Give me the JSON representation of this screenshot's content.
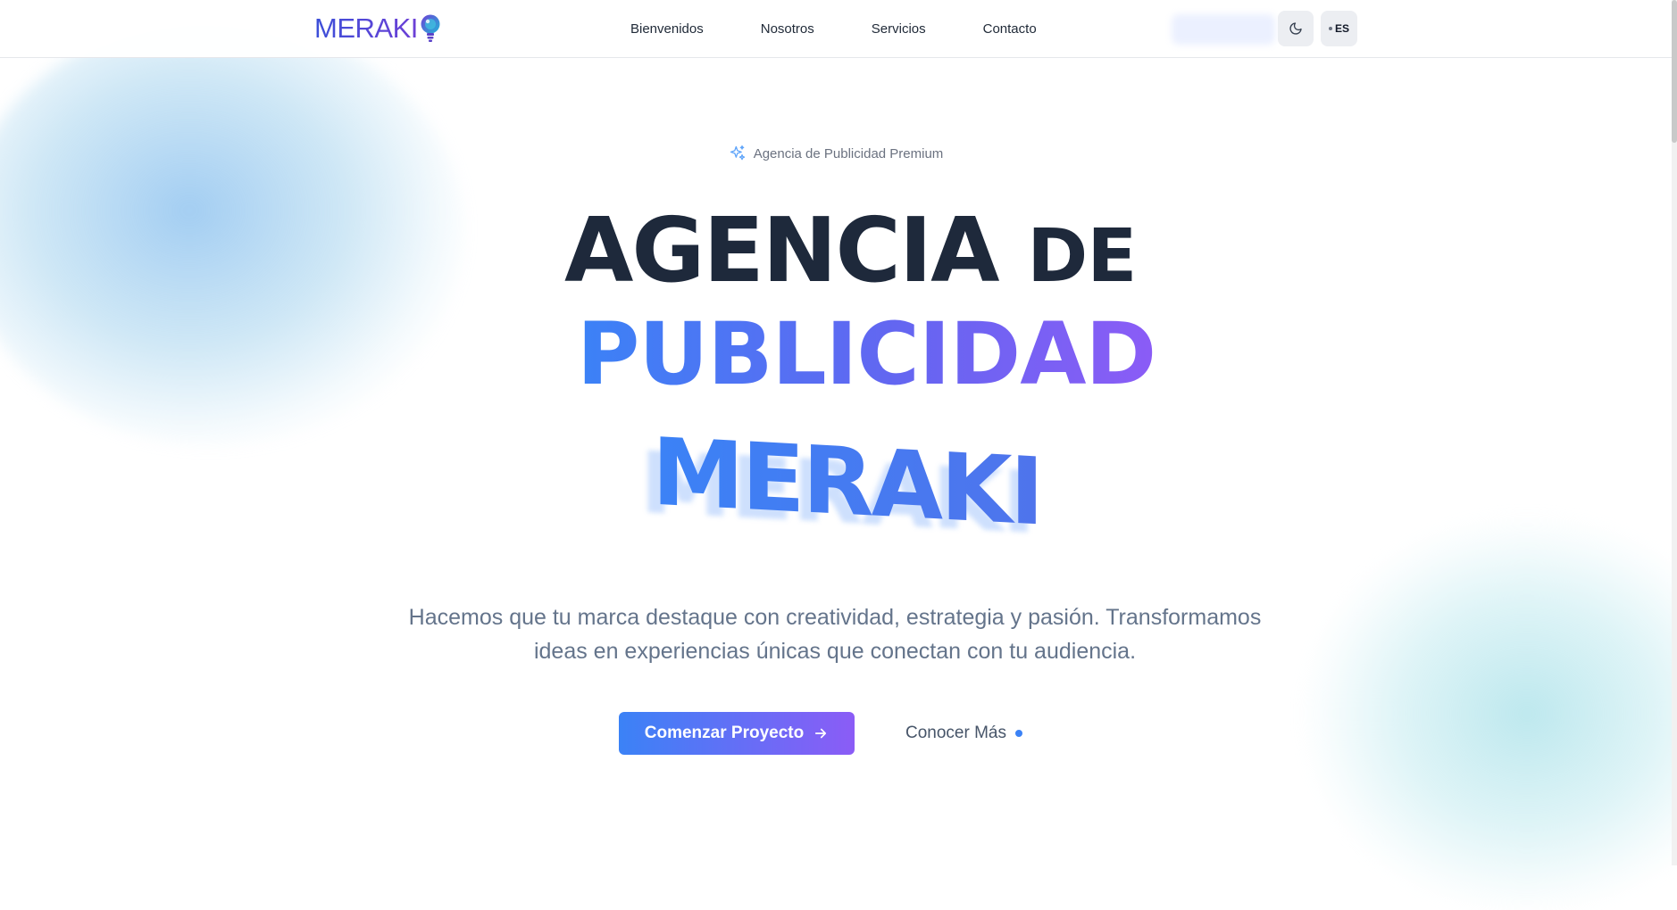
{
  "header": {
    "logo_text": "MERAKI",
    "logo_icon": "lightbulb-icon",
    "nav": [
      {
        "label": "Bienvenidos"
      },
      {
        "label": "Nosotros"
      },
      {
        "label": "Servicios"
      },
      {
        "label": "Contacto"
      }
    ],
    "theme_toggle_icon": "moon-icon",
    "language": "ES"
  },
  "hero": {
    "badge_icon": "sparkles-icon",
    "badge": "Agencia de Publicidad Premium",
    "title_line1_a": "AGENCIA",
    "title_line1_b": "DE",
    "title_line2": "PUBLICIDAD",
    "brand": "MERAKI",
    "subtitle": "Hacemos que tu marca destaque con creatividad, estrategia y pasión. Transformamos ideas en experiencias únicas que conectan con tu audiencia.",
    "primary_cta": "Comenzar Proyecto",
    "primary_cta_icon": "arrow-right-icon",
    "secondary_cta": "Conocer Más"
  },
  "colors": {
    "accent_blue": "#3b82f6",
    "accent_purple": "#8b5cf6",
    "heading_dark": "#1e293b",
    "text_muted": "#64748b"
  }
}
